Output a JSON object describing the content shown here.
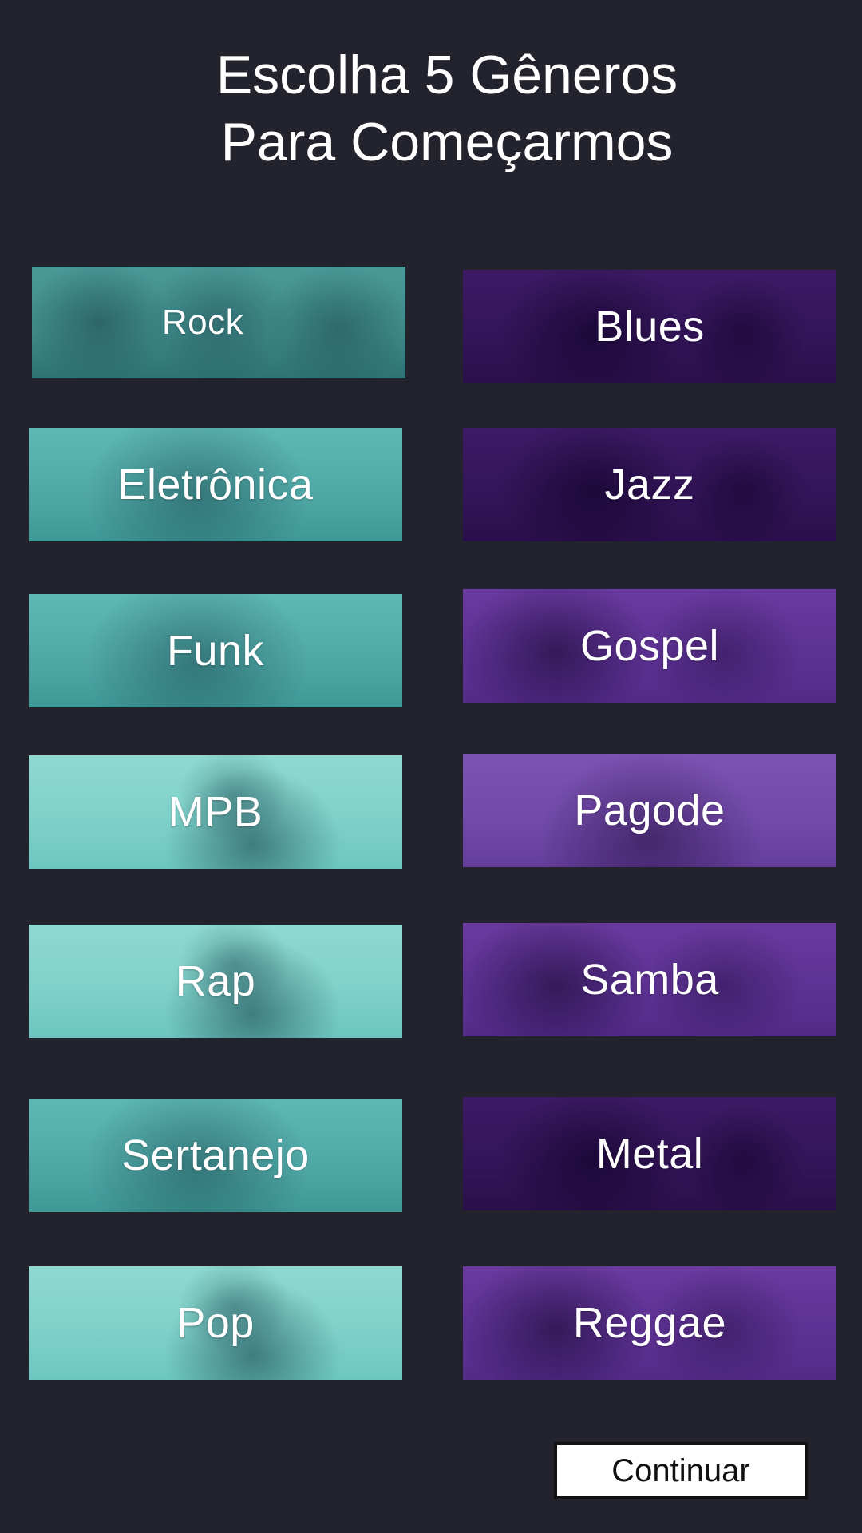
{
  "header": {
    "title_line1": "Escolha 5  Gêneros",
    "title_line2": "Para Começarmos"
  },
  "genres": {
    "rock": "Rock",
    "blues": "Blues",
    "eletronica": "Eletrônica",
    "jazz": "Jazz",
    "funk": "Funk",
    "gospel": "Gospel",
    "mpb": "MPB",
    "pagode": "Pagode",
    "rap": "Rap",
    "samba": "Samba",
    "sertanejo": "Sertanejo",
    "metal": "Metal",
    "pop": "Pop",
    "reggae": "Reggae"
  },
  "footer": {
    "continue_label": "Continuar"
  },
  "colors": {
    "background": "#23232d",
    "teal_overlay": "#7fd1ca",
    "purple_overlay": "#5e3295"
  }
}
